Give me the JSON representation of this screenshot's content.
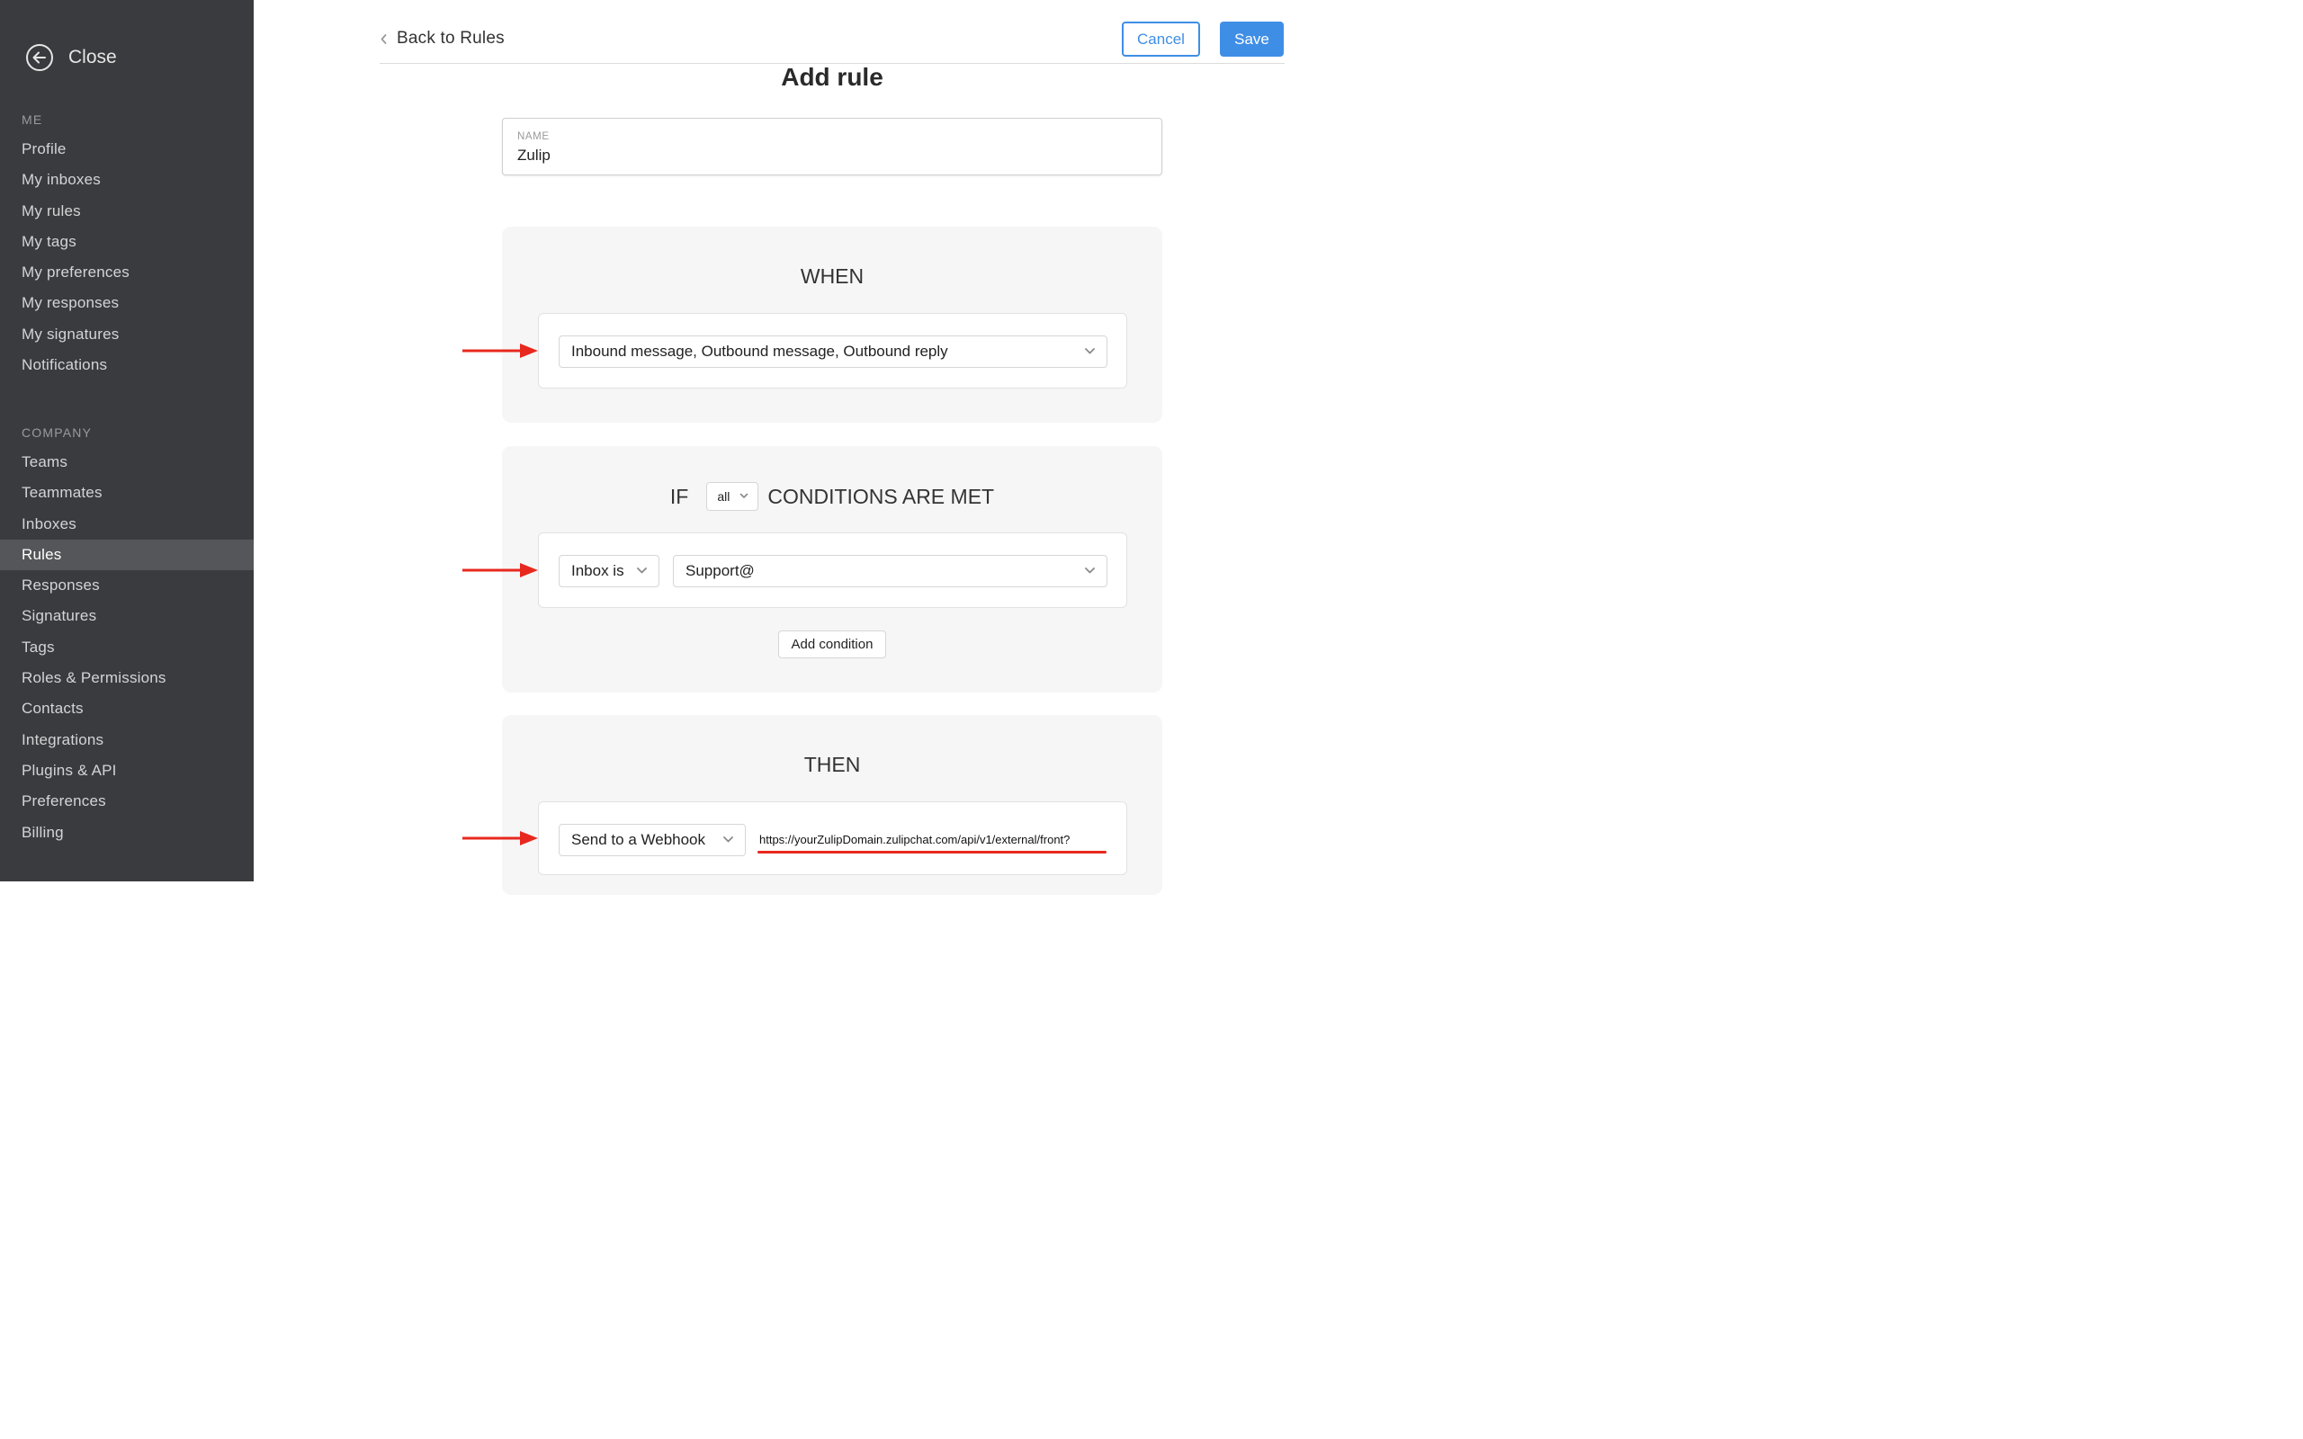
{
  "sidebar": {
    "close_label": "Close",
    "me_title": "ME",
    "me_items": [
      {
        "label": "Profile"
      },
      {
        "label": "My inboxes"
      },
      {
        "label": "My rules"
      },
      {
        "label": "My tags"
      },
      {
        "label": "My preferences"
      },
      {
        "label": "My responses"
      },
      {
        "label": "My signatures"
      },
      {
        "label": "Notifications"
      }
    ],
    "company_title": "COMPANY",
    "company_items": [
      {
        "label": "Teams"
      },
      {
        "label": "Teammates"
      },
      {
        "label": "Inboxes"
      },
      {
        "label": "Rules",
        "active": true
      },
      {
        "label": "Responses"
      },
      {
        "label": "Signatures"
      },
      {
        "label": "Tags"
      },
      {
        "label": "Roles & Permissions"
      },
      {
        "label": "Contacts"
      },
      {
        "label": "Integrations"
      },
      {
        "label": "Plugins & API"
      },
      {
        "label": "Preferences"
      },
      {
        "label": "Billing"
      }
    ]
  },
  "header": {
    "back_label": "Back to Rules",
    "cancel_label": "Cancel",
    "save_label": "Save"
  },
  "page": {
    "title": "Add rule"
  },
  "name_field": {
    "label": "NAME",
    "value": "Zulip"
  },
  "when_section": {
    "heading": "WHEN",
    "trigger_value": "Inbound message, Outbound message, Outbound reply"
  },
  "if_section": {
    "if_word": "IF",
    "match_value": "all",
    "conditions_word": "CONDITIONS ARE MET",
    "condition_field": "Inbox is",
    "condition_value": "Support@",
    "add_condition_label": "Add condition"
  },
  "then_section": {
    "heading": "THEN",
    "action_value": "Send to a Webhook",
    "webhook_url": "https://yourZulipDomain.zulipchat.com/api/v1/external/front?"
  },
  "colors": {
    "sidebar_bg": "#3a3b3e",
    "sidebar_active": "#55565a",
    "accent": "#3f8ee6",
    "annotation": "#e8281e",
    "panel_bg": "#f6f6f6"
  },
  "icons": {
    "close": "arrow-left-circle-icon",
    "back": "chevron-left-icon",
    "dropdown": "chevron-down-icon",
    "annotation": "red-arrow-icon"
  }
}
